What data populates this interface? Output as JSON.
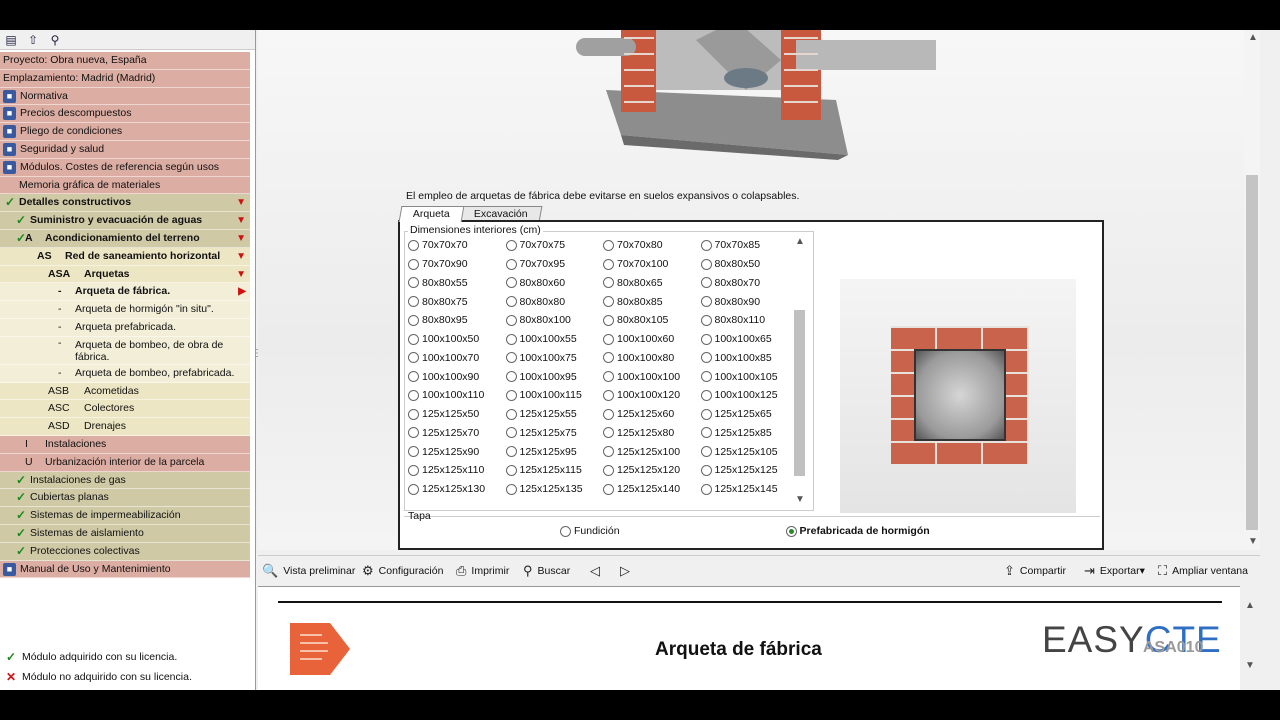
{
  "sidebar": {
    "tree": [
      {
        "label": "Proyecto: Obra nueva, España",
        "style": "salmon"
      },
      {
        "label": "Emplazamiento: Madrid (Madrid)",
        "style": "salmon"
      },
      {
        "label": "Normativa",
        "style": "salmon",
        "icon": "book-icon"
      },
      {
        "label": "Precios descompuestos",
        "style": "salmon",
        "icon": "price-icon"
      },
      {
        "label": "Pliego de condiciones",
        "style": "salmon",
        "icon": "document-icon"
      },
      {
        "label": "Seguridad y salud",
        "style": "salmon",
        "icon": "helmet-icon"
      },
      {
        "label": "Módulos. Costes de referencia según usos",
        "style": "salmon",
        "icon": "modules-icon"
      },
      {
        "label": "Memoria gráfica de materiales",
        "style": "salmon"
      },
      {
        "label": "Detalles constructivos",
        "style": "olive",
        "check": true,
        "bold": true,
        "expanded": true
      },
      {
        "label": "Suministro y evacuación de aguas",
        "style": "olive",
        "check": true,
        "bold": true,
        "expanded": true
      },
      {
        "code": "A",
        "label": "Acondicionamiento del terreno",
        "style": "olive",
        "check": true,
        "bold": true,
        "expanded": true
      },
      {
        "code": "AS",
        "label": "Red de saneamiento horizontal",
        "style": "cream",
        "bold": true,
        "expanded": true
      },
      {
        "code": "ASA",
        "label": "Arquetas",
        "style": "cream",
        "bold": true,
        "expanded": true
      },
      {
        "label": "Arqueta de fábrica.",
        "style": "pale",
        "bold": true,
        "selected": true
      },
      {
        "label": "Arqueta de hormigón \"in situ\".",
        "style": "pale"
      },
      {
        "label": "Arqueta prefabricada.",
        "style": "pale"
      },
      {
        "label": "Arqueta de bombeo, de obra de fábrica.",
        "style": "pale",
        "tall": true
      },
      {
        "label": "Arqueta de bombeo, prefabricada.",
        "style": "pale"
      },
      {
        "code": "ASB",
        "label": "Acometidas",
        "style": "cream"
      },
      {
        "code": "ASC",
        "label": "Colectores",
        "style": "cream"
      },
      {
        "code": "ASD",
        "label": "Drenajes",
        "style": "cream"
      },
      {
        "code": "I",
        "label": "Instalaciones",
        "style": "salmon"
      },
      {
        "code": "U",
        "label": "Urbanización interior de la parcela",
        "style": "salmon"
      },
      {
        "label": "Instalaciones de gas",
        "style": "olive",
        "check": true
      },
      {
        "label": "Cubiertas planas",
        "style": "olive",
        "check": true
      },
      {
        "label": "Sistemas de impermeabilización",
        "style": "olive",
        "check": true
      },
      {
        "label": "Sistemas de aislamiento",
        "style": "olive",
        "check": true
      },
      {
        "label": "Protecciones colectivas",
        "style": "olive",
        "check": true
      },
      {
        "label": "Manual de Uso y Mantenimiento",
        "style": "salmon",
        "icon": "manual-icon"
      }
    ],
    "legend": {
      "acquired": "Módulo adquirido con su licencia.",
      "not_acquired": "Módulo no adquirido con su licencia."
    }
  },
  "content": {
    "note": "El empleo de arquetas de fábrica debe evitarse en suelos expansivos o colapsables.",
    "tabs": [
      "Arqueta",
      "Excavación"
    ],
    "dims_title": "Dimensiones interiores (cm)",
    "dimensions": [
      "70x70x70",
      "70x70x75",
      "70x70x80",
      "70x70x85",
      "70x70x90",
      "70x70x95",
      "70x70x100",
      "80x80x50",
      "80x80x55",
      "80x80x60",
      "80x80x65",
      "80x80x70",
      "80x80x75",
      "80x80x80",
      "80x80x85",
      "80x80x90",
      "80x80x95",
      "80x80x100",
      "80x80x105",
      "80x80x110",
      "100x100x50",
      "100x100x55",
      "100x100x60",
      "100x100x65",
      "100x100x70",
      "100x100x75",
      "100x100x80",
      "100x100x85",
      "100x100x90",
      "100x100x95",
      "100x100x100",
      "100x100x105",
      "100x100x110",
      "100x100x115",
      "100x100x120",
      "100x100x125",
      "125x125x50",
      "125x125x55",
      "125x125x60",
      "125x125x65",
      "125x125x70",
      "125x125x75",
      "125x125x80",
      "125x125x85",
      "125x125x90",
      "125x125x95",
      "125x125x100",
      "125x125x105",
      "125x125x110",
      "125x125x115",
      "125x125x120",
      "125x125x125",
      "125x125x130",
      "125x125x135",
      "125x125x140",
      "125x125x145"
    ],
    "tapa": {
      "label": "Tapa",
      "options": [
        "Fundición",
        "Prefabricada de hormigón"
      ],
      "selected": "Prefabricada de hormigón"
    }
  },
  "toolbar": {
    "preview": "Vista preliminar",
    "config": "Configuración",
    "print": "Imprimir",
    "search": "Buscar",
    "share": "Compartir",
    "export": "Exportar",
    "enlarge": "Ampliar ventana"
  },
  "report": {
    "title": "Arqueta de fábrica",
    "brand_a": "EASY",
    "brand_b": "CTE",
    "code": "ASA010"
  },
  "colors": {
    "accent_red": "#d01010",
    "check_green": "#1a8a1a",
    "brick": "#c9634c",
    "brand_blue": "#2e6fc4"
  }
}
